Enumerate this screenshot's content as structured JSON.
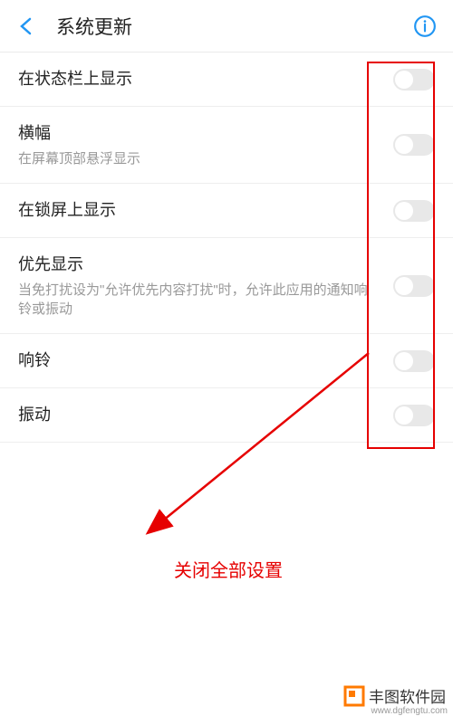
{
  "header": {
    "title": "系统更新"
  },
  "settings": [
    {
      "label": "在状态栏上显示",
      "sub": "",
      "on": false
    },
    {
      "label": "横幅",
      "sub": "在屏幕顶部悬浮显示",
      "on": false
    },
    {
      "label": "在锁屏上显示",
      "sub": "",
      "on": false
    },
    {
      "label": "优先显示",
      "sub": "当免打扰设为\"允许优先内容打扰\"时，允许此应用的通知响铃或振动",
      "on": false
    },
    {
      "label": "响铃",
      "sub": "",
      "on": false
    },
    {
      "label": "振动",
      "sub": "",
      "on": false
    }
  ],
  "annotation": {
    "text": "关闭全部设置"
  },
  "watermark": {
    "name": "丰图软件园",
    "url": "www.dgfengtu.com"
  }
}
